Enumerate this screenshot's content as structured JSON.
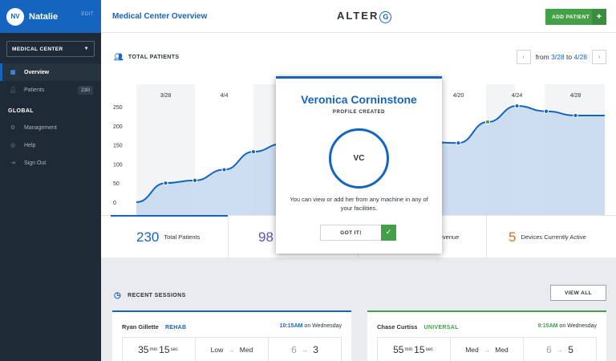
{
  "sidebar": {
    "user_initials": "NV",
    "user_name": "Natalie",
    "edit_label": "EDIT",
    "facility_select": "MEDICAL CENTER",
    "nav": [
      {
        "label": "Overview",
        "icon": "dashboard-icon",
        "active": true
      },
      {
        "label": "Patients",
        "icon": "user-icon",
        "count": "230"
      }
    ],
    "global_label": "GLOBAL",
    "global_items": [
      {
        "label": "Management",
        "icon": "gear-icon"
      },
      {
        "label": "Help",
        "icon": "help-icon"
      },
      {
        "label": "Sign Out",
        "icon": "sign-out-icon"
      }
    ]
  },
  "header": {
    "title": "Medical Center Overview",
    "logo_text": "ALTER",
    "logo_letter": "G",
    "add_patient_label": "ADD PATIENT",
    "add_patient_plus": "+"
  },
  "total_patients": {
    "title": "TOTAL PATIENTS",
    "range_from_label": "from",
    "range_from": "3/28",
    "range_to_label": "to",
    "range_to": "4/28",
    "prev_arrow": "‹",
    "next_arrow": "›"
  },
  "chart_data": {
    "type": "area",
    "x_ticks": [
      "3/28",
      "4/4",
      "4/20",
      "4/24",
      "4/28"
    ],
    "y_ticks": [
      "250",
      "200",
      "150",
      "100",
      "50",
      "0"
    ],
    "ylim": [
      0,
      250
    ],
    "points": [
      {
        "i": 0,
        "y": 0
      },
      {
        "i": 1,
        "y": 50
      },
      {
        "i": 2,
        "y": 57
      },
      {
        "i": 3,
        "y": 85
      },
      {
        "i": 4,
        "y": 132
      },
      {
        "i": 5,
        "y": 153
      },
      {
        "i": 6,
        "y": 156
      },
      {
        "i": 7,
        "y": 156
      },
      {
        "i": 8,
        "y": 158
      },
      {
        "i": 9,
        "y": 157
      },
      {
        "i": 10,
        "y": 157
      },
      {
        "i": 11,
        "y": 155
      },
      {
        "i": 12,
        "y": 210
      },
      {
        "i": 13,
        "y": 252
      },
      {
        "i": 14,
        "y": 238
      },
      {
        "i": 15,
        "y": 227
      },
      {
        "i": 16,
        "y": 227
      }
    ],
    "colors": {
      "line": "#1565c0",
      "fill": "#c5d8ee",
      "highlight_point": "#43a047"
    },
    "grid": false
  },
  "stats": [
    {
      "value": "230",
      "label": "Total Patients",
      "color": "#1565c0"
    },
    {
      "value": "98",
      "label": "",
      "color": "#5c4fc6"
    },
    {
      "value": "",
      "label": "n Revenue",
      "color": "#2b3238"
    },
    {
      "value": "5",
      "label": "Devices Currently Active",
      "color": "#e06c1e"
    }
  ],
  "recent_sessions": {
    "title": "RECENT SESSIONS",
    "view_all_label": "VIEW ALL",
    "sessions": [
      {
        "name": "Ryan Gillette",
        "type": "REHAB",
        "type_color": "#1565c0",
        "time": "10:15AM",
        "day": "on Wednesday",
        "duration_min": "35",
        "duration_sec": "15",
        "min_unit": "min",
        "sec_unit": "sec",
        "function_from": "Low",
        "function_to": "Med",
        "pain_from": "6",
        "pain_to": "3"
      },
      {
        "name": "Chase Curtiss",
        "type": "UNIVERSAL",
        "type_color": "#43a047",
        "time": "9:15AM",
        "day": "on Wednesday",
        "duration_min": "55",
        "duration_sec": "15",
        "min_unit": "min",
        "sec_unit": "sec",
        "function_from": "Med",
        "function_to": "Med",
        "pain_from": "6",
        "pain_to": "5"
      }
    ]
  },
  "modal": {
    "name": "Veronica Corninstone",
    "subtitle": "PROFILE CREATED",
    "initials": "VC",
    "message": "You can view or add her from any machine in any of your facilities.",
    "button_label": "GOT IT!",
    "check_glyph": "✓"
  }
}
